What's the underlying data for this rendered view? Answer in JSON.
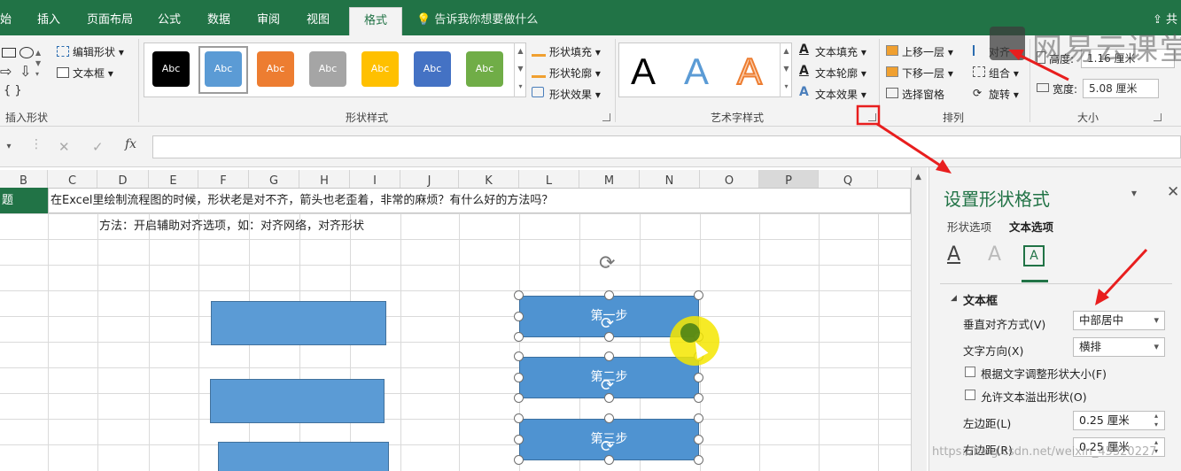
{
  "tabs": [
    "始",
    "插入",
    "页面布局",
    "公式",
    "数据",
    "审阅",
    "视图",
    "格式"
  ],
  "active_tab": "格式",
  "tell_me": "告诉我你想要做什么",
  "share": "共",
  "ribbon": {
    "insert_shapes": {
      "edit_shape": "编辑形状",
      "text_box": "文本框",
      "label": "插入形状"
    },
    "shape_styles": {
      "sample_text": "Abc",
      "swatches": [
        "#000000",
        "#5b9bd5",
        "#ed7d31",
        "#a5a5a5",
        "#ffc000",
        "#4472c4",
        "#70ad47"
      ],
      "fill": "形状填充",
      "outline": "形状轮廓",
      "effects": "形状效果",
      "label": "形状样式"
    },
    "wordart": {
      "letter": "A",
      "fill": "文本填充",
      "outline": "文本轮廓",
      "effects": "文本效果",
      "label": "艺术字样式"
    },
    "arrange": {
      "bring_forward": "上移一层",
      "send_backward": "下移一层",
      "selection_pane": "选择窗格",
      "align": "对齐",
      "group": "组合",
      "rotate": "旋转",
      "label": "排列"
    },
    "size": {
      "height_label": "高度:",
      "height_value": "1.16 厘米",
      "width_label": "宽度:",
      "width_value": "5.08 厘米",
      "label": "大小"
    }
  },
  "formula_bar": {
    "name_box": "",
    "fx": "fx",
    "cancel": "✕",
    "enter": "✓",
    "value": ""
  },
  "columns": [
    "B",
    "C",
    "D",
    "E",
    "F",
    "G",
    "H",
    "I",
    "J",
    "K",
    "L",
    "M",
    "N",
    "O",
    "P",
    "Q"
  ],
  "selected_column": "P",
  "cells": {
    "b2": "题",
    "c2": "在Excel里绘制流程图的时候，形状老是对不齐，箭头也老歪着，非常的麻烦？有什么好的方法吗？",
    "d3": "方法：开启辅助对齐选项，如：对齐网络，对齐形状"
  },
  "shapes": {
    "step1": "第一步",
    "step2": "第二步",
    "step3": "第三步"
  },
  "pane": {
    "title": "设置形状格式",
    "tab_shape": "形状选项",
    "tab_text": "文本选项",
    "section": "文本框",
    "valign_label": "垂直对齐方式(V)",
    "valign_value": "中部居中",
    "direction_label": "文字方向(X)",
    "direction_value": "横排",
    "autofit_label": "根据文字调整形状大小(F)",
    "overflow_label": "允许文本溢出形状(O)",
    "left_margin_label": "左边距(L)",
    "left_margin_value": "0.25 厘米",
    "right_margin_label": "右边距(R)",
    "right_margin_value": "0.25 厘米"
  },
  "watermark": "网易云课堂",
  "url_watermark": "https://blog.csdn.net/weixin_45320227",
  "colors": {
    "excel_green": "#217346",
    "shape_blue": "#5b9bd5",
    "annotation_red": "#e81e1e",
    "cursor_highlight": "#f5e600"
  }
}
